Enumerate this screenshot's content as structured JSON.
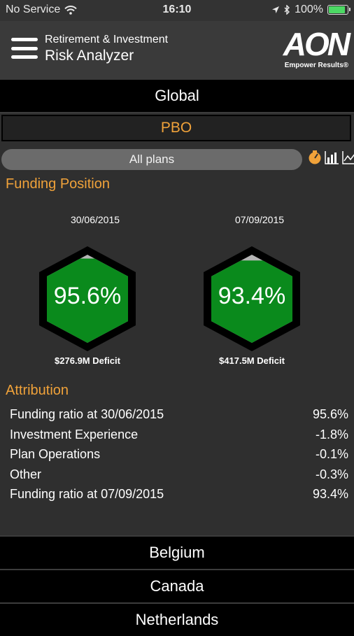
{
  "status": {
    "carrier": "No Service",
    "time": "16:10",
    "battery_pct": "100%",
    "battery_level": 1.0
  },
  "header": {
    "line1": "Retirement & Investment",
    "line2": "Risk Analyzer",
    "logo": "AON",
    "tagline": "Empower Results®"
  },
  "nav": {
    "global": "Global",
    "pbo": "PBO"
  },
  "plans": {
    "label": "All plans"
  },
  "funding": {
    "title": "Funding Position",
    "positions": [
      {
        "date": "30/06/2015",
        "value": "95.6%",
        "deficit": "$276.9M Deficit",
        "fill_level": 0.956
      },
      {
        "date": "07/09/2015",
        "value": "93.4%",
        "deficit": "$417.5M Deficit",
        "fill_level": 0.934
      }
    ]
  },
  "attribution": {
    "title": "Attribution",
    "rows": [
      {
        "label": "Funding ratio at 30/06/2015",
        "value": "95.6%"
      },
      {
        "label": "Investment Experience",
        "value": "-1.8%"
      },
      {
        "label": "Plan Operations",
        "value": "-0.1%"
      },
      {
        "label": "Other",
        "value": "-0.3%"
      },
      {
        "label": "Funding ratio at 07/09/2015",
        "value": "93.4%"
      }
    ]
  },
  "countries": [
    "Belgium",
    "Canada",
    "Netherlands"
  ],
  "colors": {
    "accent": "#f0a23a",
    "fill_green": "#0a8a1c",
    "empty_gray": "#b5b5b5"
  }
}
